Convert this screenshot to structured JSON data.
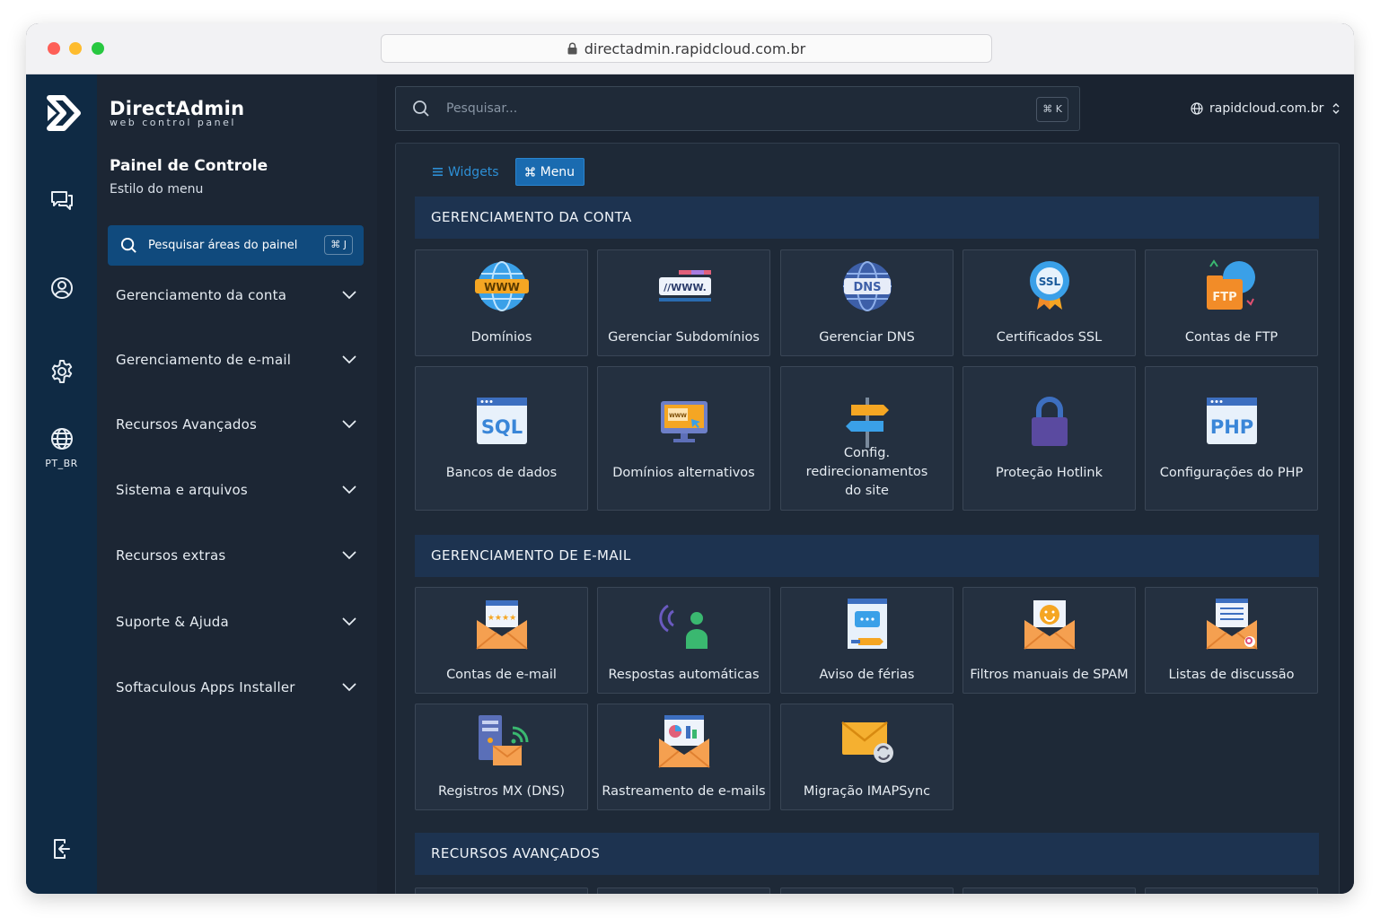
{
  "browser": {
    "url": "directadmin.rapidcloud.com.br"
  },
  "rail": {
    "lang_label": "PT_BR"
  },
  "brand": {
    "name": "DirectAdmin",
    "tagline": "web control panel"
  },
  "panel": {
    "title": "Painel de Controle",
    "subtitle": "Estilo do menu",
    "search_label": "Pesquisar áreas do painel",
    "search_shortcut": "⌘ J",
    "nav": [
      "Gerenciamento da conta",
      "Gerenciamento de e-mail",
      "Recursos Avançados",
      "Sistema e arquivos",
      "Recursos extras",
      "Suporte & Ajuda",
      "Softaculous Apps Installer"
    ]
  },
  "topbar": {
    "search_placeholder": "Pesquisar...",
    "search_shortcut": "⌘ K",
    "domain": "rapidcloud.com.br"
  },
  "view_tabs": {
    "widgets": "Widgets",
    "menu": "Menu",
    "active": "menu"
  },
  "sections": [
    {
      "title": "GERENCIAMENTO DA CONTA",
      "items": [
        {
          "label": "Domínios",
          "icon": "globe-www-icon"
        },
        {
          "label": "Gerenciar Subdomínios",
          "icon": "subdomain-www-icon"
        },
        {
          "label": "Gerenciar DNS",
          "icon": "dns-globe-icon"
        },
        {
          "label": "Certificados SSL",
          "icon": "ssl-badge-icon"
        },
        {
          "label": "Contas de FTP",
          "icon": "ftp-folder-icon"
        },
        {
          "label": "Bancos de dados",
          "icon": "sql-database-icon"
        },
        {
          "label": "Domínios alternativos",
          "icon": "monitor-www-icon"
        },
        {
          "label": "Config. redirecionamentos do site",
          "icon": "signpost-icon"
        },
        {
          "label": "Proteção Hotlink",
          "icon": "padlock-icon"
        },
        {
          "label": "Configurações do PHP",
          "icon": "php-window-icon"
        }
      ]
    },
    {
      "title": "GERENCIAMENTO DE E-MAIL",
      "items": [
        {
          "label": "Contas de e-mail",
          "icon": "envelope-stars-icon"
        },
        {
          "label": "Respostas automáticas",
          "icon": "auto-reply-person-icon"
        },
        {
          "label": "Aviso de férias",
          "icon": "vacation-notice-icon"
        },
        {
          "label": "Filtros manuais de SPAM",
          "icon": "spam-filter-envelope-icon"
        },
        {
          "label": "Listas de discussão",
          "icon": "mailing-list-envelope-icon"
        },
        {
          "label": "Registros MX (DNS)",
          "icon": "mx-server-envelope-icon"
        },
        {
          "label": "Rastreamento de e-mails",
          "icon": "email-tracking-icon"
        },
        {
          "label": "Migração IMAPSync",
          "icon": "imapsync-envelope-icon"
        }
      ]
    },
    {
      "title": "RECURSOS AVANÇADOS",
      "items": []
    }
  ],
  "colors": {
    "rail_bg": "#0f2a44",
    "panel_bg": "#1c2634",
    "accent": "#1a6bb0",
    "section_bg": "#1d3350",
    "card_bg": "#243040"
  }
}
